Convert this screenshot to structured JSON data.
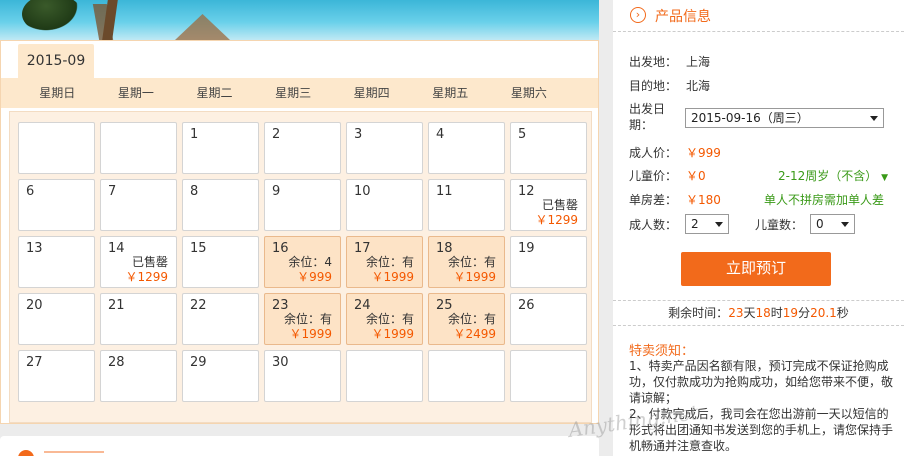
{
  "calendar": {
    "month": "2015-09",
    "weekdays": [
      "星期日",
      "星期一",
      "星期二",
      "星期三",
      "星期四",
      "星期五",
      "星期六"
    ],
    "cells": [
      {
        "day": "",
        "status": "",
        "price": "",
        "available": false
      },
      {
        "day": "",
        "status": "",
        "price": "",
        "available": false
      },
      {
        "day": "1",
        "status": "",
        "price": "",
        "available": false
      },
      {
        "day": "2",
        "status": "",
        "price": "",
        "available": false
      },
      {
        "day": "3",
        "status": "",
        "price": "",
        "available": false
      },
      {
        "day": "4",
        "status": "",
        "price": "",
        "available": false
      },
      {
        "day": "5",
        "status": "",
        "price": "",
        "available": false
      },
      {
        "day": "6",
        "status": "",
        "price": "",
        "available": false
      },
      {
        "day": "7",
        "status": "",
        "price": "",
        "available": false
      },
      {
        "day": "8",
        "status": "",
        "price": "",
        "available": false
      },
      {
        "day": "9",
        "status": "",
        "price": "",
        "available": false
      },
      {
        "day": "10",
        "status": "",
        "price": "",
        "available": false
      },
      {
        "day": "11",
        "status": "",
        "price": "",
        "available": false
      },
      {
        "day": "12",
        "status": "已售罄",
        "price": "￥1299",
        "available": false
      },
      {
        "day": "13",
        "status": "",
        "price": "",
        "available": false
      },
      {
        "day": "14",
        "status": "已售罄",
        "price": "￥1299",
        "available": false
      },
      {
        "day": "15",
        "status": "",
        "price": "",
        "available": false
      },
      {
        "day": "16",
        "status": "余位：4",
        "price": "￥999",
        "available": true
      },
      {
        "day": "17",
        "status": "余位：有",
        "price": "￥1999",
        "available": true
      },
      {
        "day": "18",
        "status": "余位：有",
        "price": "￥1999",
        "available": true
      },
      {
        "day": "19",
        "status": "",
        "price": "",
        "available": false
      },
      {
        "day": "20",
        "status": "",
        "price": "",
        "available": false
      },
      {
        "day": "21",
        "status": "",
        "price": "",
        "available": false
      },
      {
        "day": "22",
        "status": "",
        "price": "",
        "available": false
      },
      {
        "day": "23",
        "status": "余位：有",
        "price": "￥1999",
        "available": true
      },
      {
        "day": "24",
        "status": "余位：有",
        "price": "￥1999",
        "available": true
      },
      {
        "day": "25",
        "status": "余位：有",
        "price": "￥2499",
        "available": true
      },
      {
        "day": "26",
        "status": "",
        "price": "",
        "available": false
      },
      {
        "day": "27",
        "status": "",
        "price": "",
        "available": false
      },
      {
        "day": "28",
        "status": "",
        "price": "",
        "available": false
      },
      {
        "day": "29",
        "status": "",
        "price": "",
        "available": false
      },
      {
        "day": "30",
        "status": "",
        "price": "",
        "available": false
      },
      {
        "day": "",
        "status": "",
        "price": "",
        "available": false
      },
      {
        "day": "",
        "status": "",
        "price": "",
        "available": false
      },
      {
        "day": "",
        "status": "",
        "price": "",
        "available": false
      }
    ]
  },
  "product": {
    "title": "产品信息",
    "departure_label": "出发地：",
    "departure": "上海",
    "destination_label": "目的地：",
    "destination": "北海",
    "date_label_1": "出发日",
    "date_label_2": "期：",
    "date_value": "2015-09-16（周三）",
    "adult_price_label": "成人价：",
    "adult_price": "￥999",
    "child_price_label": "儿童价：",
    "child_price": "￥0",
    "child_note": "2-12周岁（不含）",
    "single_label": "单房差：",
    "single_price": "￥180",
    "single_note": "单人不拼房需加单人差",
    "adult_count_label": "成人数：",
    "adult_count": "2",
    "child_count_label": "儿童数：",
    "child_count": "0",
    "book_label": "立即预订"
  },
  "countdown": {
    "prefix": "剩余时间：",
    "days": "23",
    "days_unit": "天",
    "hours": "18",
    "hours_unit": "时",
    "minutes": "19",
    "minutes_unit": "分",
    "seconds": "20.1",
    "seconds_unit": "秒"
  },
  "notice": {
    "title": "特卖须知：",
    "line1": "1、特卖产品因名额有限，预订完成不保证抢购成功，仅付款成功为抢购成功，如给您带来不便，敬请谅解；",
    "line2": "2、付款完成后，我司会在您出游前一天以短信的形式将出团通知书发送到您的手机上，请您保持手机畅通并注意查收。"
  },
  "watermark": "Anything.net",
  "colors": {
    "accent": "#f26a1b",
    "price": "#f45800",
    "green": "#3a9a18",
    "available_bg": "#fde3c6"
  }
}
